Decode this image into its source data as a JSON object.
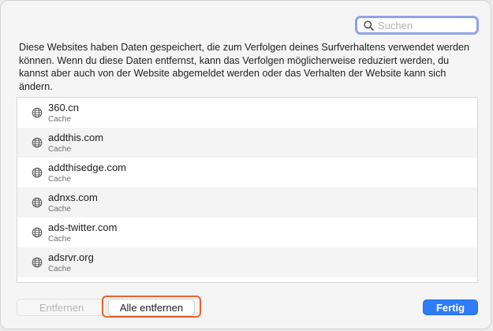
{
  "search": {
    "placeholder": "Suchen",
    "value": ""
  },
  "description": "Diese Websites haben Daten gespeichert, die zum Verfolgen deines Surfverhaltens verwendet werden können. Wenn du diese Daten entfernst, kann das Verfolgen möglicherweise reduziert werden, du kannst aber auch von der Website abgemeldet werden oder das Verhalten der Website kann sich ändern.",
  "websites": [
    {
      "domain": "360.cn",
      "data_type": "Cache",
      "icon": "globe-icon"
    },
    {
      "domain": "addthis.com",
      "data_type": "Cache",
      "icon": "globe-icon"
    },
    {
      "domain": "addthisedge.com",
      "data_type": "Cache",
      "icon": "globe-icon"
    },
    {
      "domain": "adnxs.com",
      "data_type": "Cache",
      "icon": "globe-icon"
    },
    {
      "domain": "ads-twitter.com",
      "data_type": "Cache",
      "icon": "globe-icon"
    },
    {
      "domain": "adsrvr.org",
      "data_type": "Cache",
      "icon": "globe-icon"
    }
  ],
  "buttons": {
    "remove": "Entfernen",
    "remove_all": "Alle entfernen",
    "done": "Fertig"
  },
  "colors": {
    "accent": "#2f7cf6",
    "highlight_outline": "#e8632c",
    "search_focus_ring": "#8ea3e8"
  }
}
